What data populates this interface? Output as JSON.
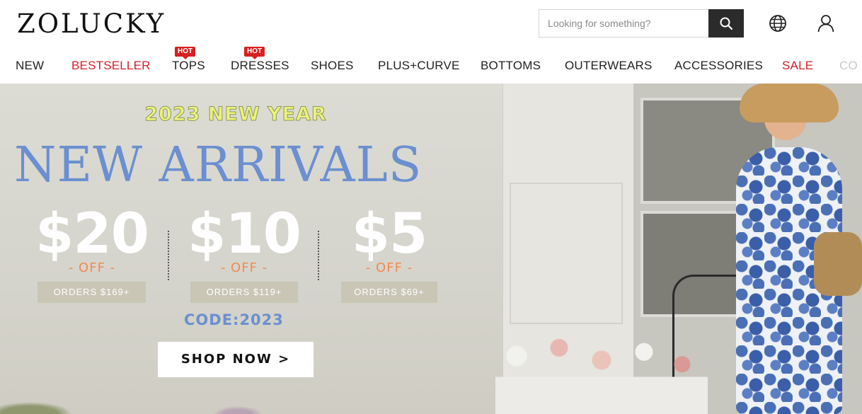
{
  "header": {
    "logo": "ZOLUCKY",
    "search_placeholder": "Looking for something?",
    "icons": [
      "search-icon",
      "globe-icon",
      "user-icon"
    ]
  },
  "nav": {
    "items": [
      {
        "label": "NEW"
      },
      {
        "label": "BESTSELLER",
        "color": "#d0202a"
      },
      {
        "label": "TOPS",
        "badge": "HOT"
      },
      {
        "label": "DRESSES",
        "badge": "HOT"
      },
      {
        "label": "SHOES"
      },
      {
        "label": "PLUS+CURVE"
      },
      {
        "label": "BOTTOMS"
      },
      {
        "label": "OUTERWEARS"
      },
      {
        "label": "ACCESSORIES"
      },
      {
        "label": "SALE",
        "color": "#d0202a"
      },
      {
        "label": "CO"
      }
    ]
  },
  "hero": {
    "year": "2023 NEW YEAR",
    "title": "NEW ARRIVALS",
    "offers": [
      {
        "price": "$20",
        "off": "- OFF -",
        "orders": "ORDERS $169+"
      },
      {
        "price": "$10",
        "off": "- OFF -",
        "orders": "ORDERS $119+"
      },
      {
        "price": "$5",
        "off": "- OFF -",
        "orders": "ORDERS $69+"
      }
    ],
    "code": "CODE:2023",
    "cta": "SHOP NOW >",
    "colors": {
      "title": "#6b8fd0",
      "year": "#eef27a",
      "off": "#f08a50"
    }
  }
}
